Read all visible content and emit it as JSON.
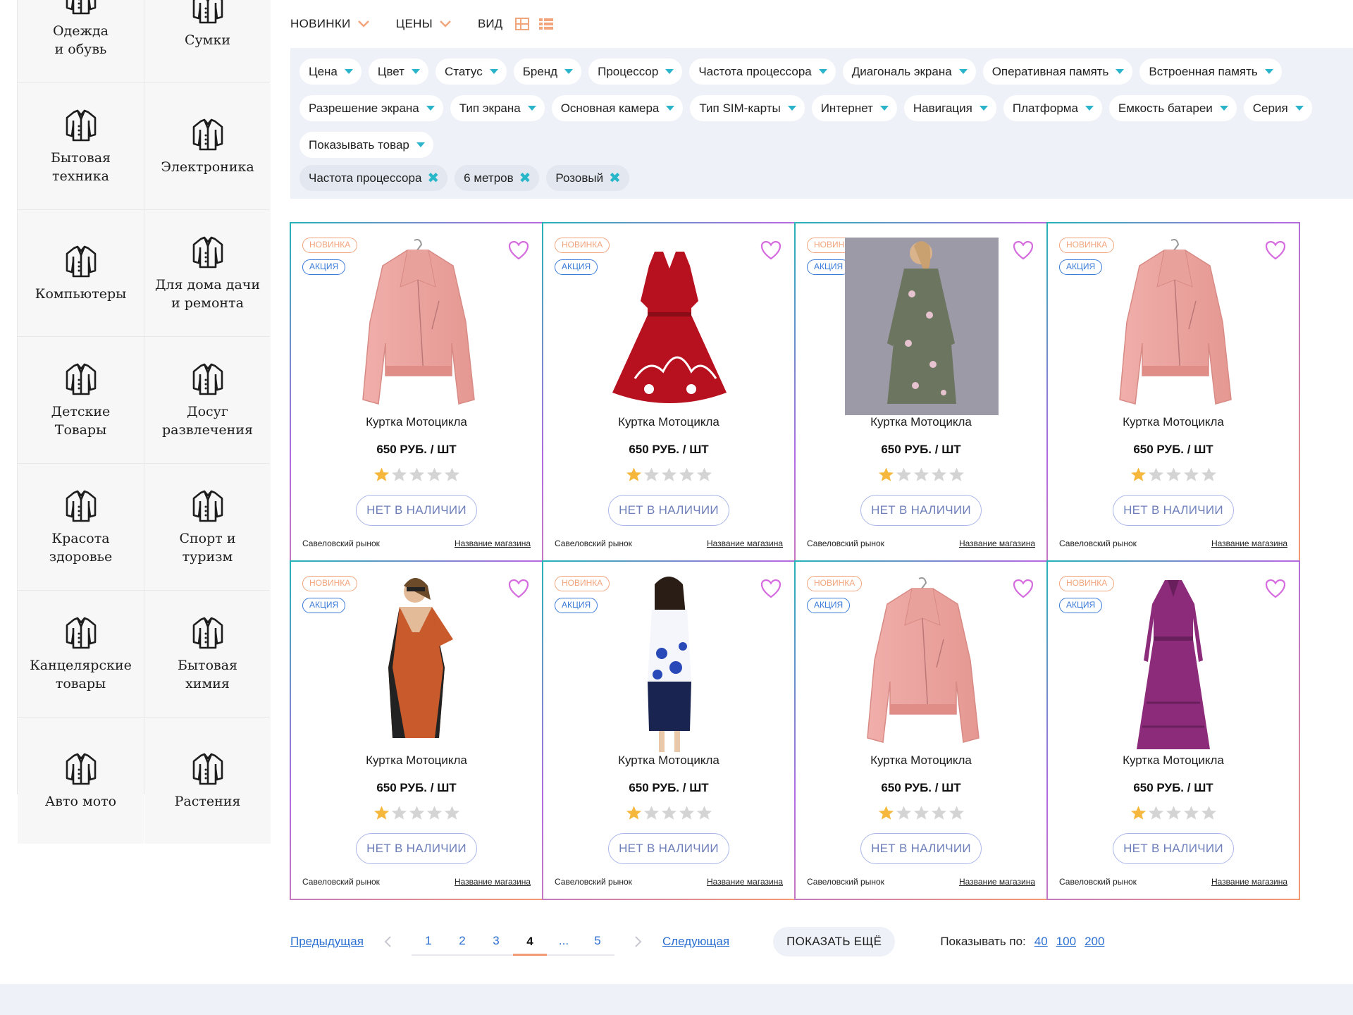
{
  "sidebar": {
    "categories": [
      {
        "label": "Одежда\nи обувь"
      },
      {
        "label": "Сумки"
      },
      {
        "label": "Бытовая\nтехника"
      },
      {
        "label": "Электроника"
      },
      {
        "label": "Компьютеры"
      },
      {
        "label": "Для дома дачи\nи ремонта"
      },
      {
        "label": "Детские\nТовары"
      },
      {
        "label": "Досуг\nразвлечения"
      },
      {
        "label": "Красота\nздоровье"
      },
      {
        "label": "Спорт и\nтуризм"
      },
      {
        "label": "Канцелярские\nтовары"
      },
      {
        "label": "Бытовая\nхимия"
      },
      {
        "label": "Авто мото"
      },
      {
        "label": "Растения"
      }
    ]
  },
  "toolbar": {
    "sort_new": "НОВИНКИ",
    "sort_price": "ЦЕНЫ",
    "view_label": "ВИД"
  },
  "filters": {
    "chips": [
      "Цена",
      "Цвет",
      "Статус",
      "Бренд",
      "Процессор",
      "Частота процессора",
      "Диагональ экрана",
      "Оперативная память",
      "Встроенная память",
      "Разрешение экрана",
      "Тип экрана",
      "Основная камера",
      "Тип SIM-карты",
      "Интернет",
      "Навигация",
      "Платформа",
      "Емкость батареи",
      "Серия",
      "Показывать товар"
    ],
    "active": [
      "Частота процессора",
      "6 метров",
      "Розовый"
    ]
  },
  "products": [
    {
      "badge_new": "НОВИНКА",
      "badge_sale": "АКЦИЯ",
      "name": "Куртка Мотоцикла",
      "price": "650 РУБ. / ШТ",
      "rating": 1,
      "stock": "НЕТ В НАЛИЧИИ",
      "market": "Савеловский рынок",
      "shop": "Название магазина",
      "image": "pink-jacket"
    },
    {
      "badge_new": "НОВИНКА",
      "badge_sale": "АКЦИЯ",
      "name": "Куртка Мотоцикла",
      "price": "650 РУБ. / ШТ",
      "rating": 1,
      "stock": "НЕТ В НАЛИЧИИ",
      "market": "Савеловский рынок",
      "shop": "Название магазина",
      "image": "red-dress"
    },
    {
      "badge_new": "НОВИНКА",
      "badge_sale": "АКЦИЯ",
      "name": "Куртка Мотоцикла",
      "price": "650 РУБ. / ШТ",
      "rating": 1,
      "stock": "НЕТ В НАЛИЧИИ",
      "market": "Савеловский рынок",
      "shop": "Название магазина",
      "image": "floral-dress"
    },
    {
      "badge_new": "НОВИНКА",
      "badge_sale": "АКЦИЯ",
      "name": "Куртка Мотоцикла",
      "price": "650 РУБ. / ШТ",
      "rating": 1,
      "stock": "НЕТ В НАЛИЧИИ",
      "market": "Савеловский рынок",
      "shop": "Название магазина",
      "image": "pink-jacket"
    },
    {
      "badge_new": "НОВИНКА",
      "badge_sale": "АКЦИЯ",
      "name": "Куртка Мотоцикла",
      "price": "650 РУБ. / ШТ",
      "rating": 1,
      "stock": "НЕТ В НАЛИЧИИ",
      "market": "Савеловский рынок",
      "shop": "Название магазина",
      "image": "orange-dress"
    },
    {
      "badge_new": "НОВИНКА",
      "badge_sale": "АКЦИЯ",
      "name": "Куртка Мотоцикла",
      "price": "650 РУБ. / ШТ",
      "rating": 1,
      "stock": "НЕТ В НАЛИЧИИ",
      "market": "Савеловский рынок",
      "shop": "Название магазина",
      "image": "blue-dress"
    },
    {
      "badge_new": "НОВИНКА",
      "badge_sale": "АКЦИЯ",
      "name": "Куртка Мотоцикла",
      "price": "650 РУБ. / ШТ",
      "rating": 1,
      "stock": "НЕТ В НАЛИЧИИ",
      "market": "Савеловский рынок",
      "shop": "Название магазина",
      "image": "pink-jacket"
    },
    {
      "badge_new": "НОВИНКА",
      "badge_sale": "АКЦИЯ",
      "name": "Куртка Мотоцикла",
      "price": "650 РУБ. / ШТ",
      "rating": 1,
      "stock": "НЕТ В НАЛИЧИИ",
      "market": "Савеловский рынок",
      "shop": "Название магазина",
      "image": "purple-dress"
    }
  ],
  "pagination": {
    "prev": "Предыдущая",
    "next": "Следующая",
    "pages": [
      "1",
      "2",
      "3",
      "4",
      "...",
      "5"
    ],
    "current": "4",
    "show_more": "ПОКАЗАТЬ ЕЩЁ",
    "per_page_label": "Показывать по:",
    "per_page_options": [
      "40",
      "100",
      "200"
    ]
  },
  "colors": {
    "accent": "#27b7c8",
    "orange": "#f2a57c",
    "star_on": "#f5b73c",
    "star_off": "#d4d4d4",
    "heart": "#d66be0"
  }
}
